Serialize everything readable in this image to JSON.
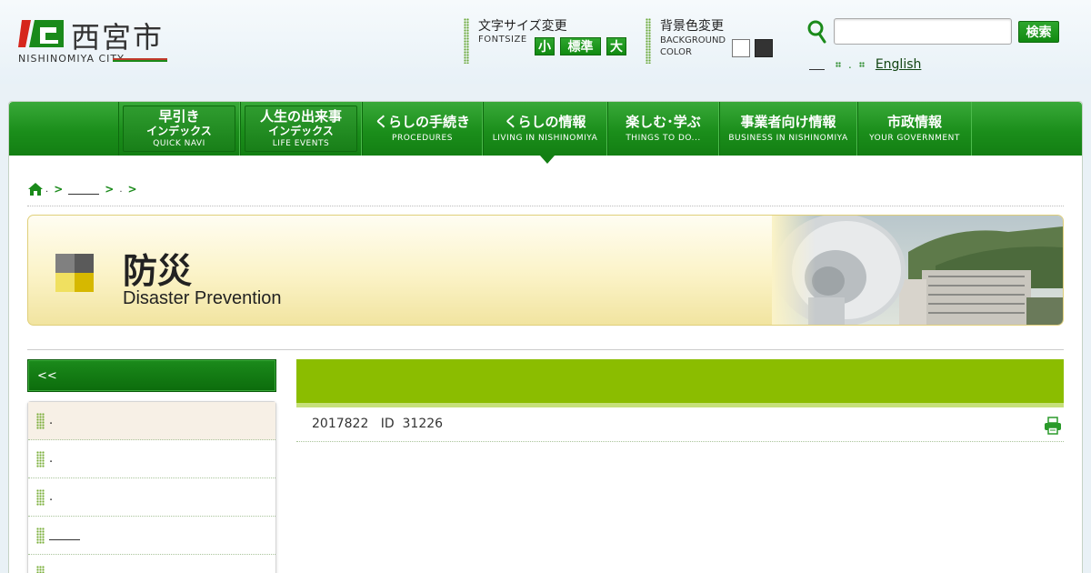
{
  "header": {
    "logo": {
      "name": "西宮市",
      "sub": "NISHINOMIYA CITY"
    },
    "fontsize": {
      "title": "文字サイズ変更",
      "sub": "FONTSIZE",
      "small": "小",
      "standard": "標準",
      "large": "大"
    },
    "background": {
      "title": "背景色変更",
      "sub": "BACKGROUND COLOR",
      "white": "#ffffff",
      "black": "#333333"
    },
    "search": {
      "value": "",
      "button": "検索"
    },
    "lang": {
      "dot": ".",
      "english": "English"
    }
  },
  "nav": {
    "items": [
      {
        "jp": "早引き",
        "jp2": "インデックス",
        "en": "QUICK NAVI"
      },
      {
        "jp": "人生の出来事",
        "jp2": "インデックス",
        "en": "LIFE EVENTS"
      },
      {
        "jp": "くらしの手続き",
        "en": "PROCEDURES"
      },
      {
        "jp": "くらしの情報",
        "en": "LIVING IN NISHINOMIYA"
      },
      {
        "jp": "楽しむ･学ぶ",
        "en": "THINGS TO DO..."
      },
      {
        "jp": "事業者向け情報",
        "en": "BUSINESS IN NISHINOMIYA"
      },
      {
        "jp": "市政情報",
        "en": "YOUR GOVERNMENT"
      }
    ]
  },
  "breadcrumb": {
    "dot": ".",
    "arrow": ">"
  },
  "banner": {
    "jp": "防災",
    "en": "Disaster Prevention"
  },
  "sidebar": {
    "head": "<<",
    "items": [
      {
        "label": "."
      },
      {
        "label": "."
      },
      {
        "label": "."
      },
      {
        "label": ""
      },
      {
        "label": "."
      }
    ]
  },
  "article": {
    "meta": "2017822   ID  31226"
  },
  "colors": {
    "green": "#1b8e1b",
    "lime": "#8bbd00",
    "banner": "#fbf3c7"
  }
}
